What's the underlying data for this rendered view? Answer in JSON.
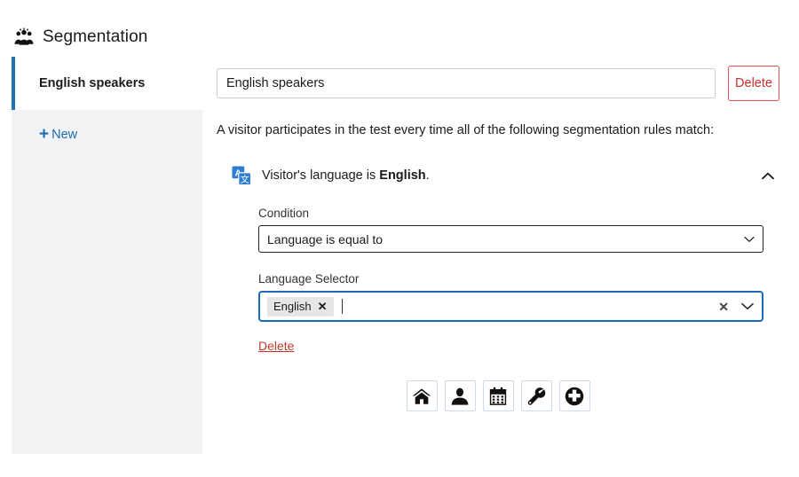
{
  "header": {
    "title": "Segmentation",
    "icon": "group-people-icon"
  },
  "sidebar": {
    "items": [
      {
        "label": "English speakers",
        "active": true
      },
      {
        "label": "New",
        "icon": "plus-icon",
        "active": false
      }
    ]
  },
  "main": {
    "name_field": {
      "value": "English speakers",
      "placeholder": "English speakers"
    },
    "delete_button_label": "Delete",
    "intro_text": "A visitor participates in the test every time all of the following segmentation rules match:",
    "rule": {
      "icon": "translate-icon",
      "title_prefix": "Visitor's language is ",
      "title_value": "English",
      "title_suffix": ".",
      "collapse_icon": "chevron-up-icon",
      "condition": {
        "label": "Condition",
        "selected": "Language is equal to",
        "options": [
          "Language is equal to"
        ],
        "chevron": "chevron-down-icon"
      },
      "language_selector": {
        "label": "Language Selector",
        "chips": [
          {
            "label": "English",
            "remove_icon": "close-icon"
          }
        ],
        "clear_icon": "close-icon",
        "chevron": "chevron-down-icon"
      },
      "delete_link_label": "Delete"
    },
    "icon_strip": [
      {
        "name": "home-icon"
      },
      {
        "name": "person-icon"
      },
      {
        "name": "calendar-icon"
      },
      {
        "name": "wrench-icon"
      },
      {
        "name": "plus-circle-icon"
      }
    ]
  },
  "colors": {
    "accent_blue": "#2272b4",
    "link_blue": "#1a6bb5",
    "danger_red": "#c9302c",
    "sidebar_bg": "#f2f3f5",
    "chip_bg": "#e6e6e6"
  }
}
